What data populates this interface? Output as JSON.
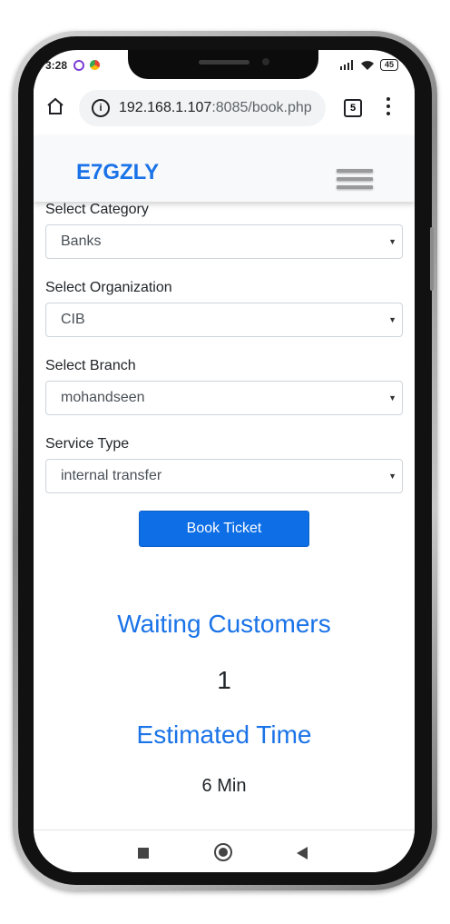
{
  "status_bar": {
    "time": "3:28",
    "battery": "45"
  },
  "browser": {
    "url_host": "192.168.1.107",
    "url_rest": ":8085/book.php",
    "tab_count": "5"
  },
  "navbar": {
    "brand": "E7GZLY"
  },
  "form": {
    "category": {
      "label": "Select Category",
      "value": "Banks"
    },
    "organization": {
      "label": "Select Organization",
      "value": "CIB"
    },
    "branch": {
      "label": "Select Branch",
      "value": "mohandseen"
    },
    "service": {
      "label": "Service Type",
      "value": "internal transfer"
    },
    "submit_label": "Book Ticket"
  },
  "queue": {
    "waiting_title": "Waiting Customers",
    "waiting_count": "1",
    "estimated_title": "Estimated Time",
    "estimated_value": "6 Min"
  },
  "colors": {
    "brand": "#1a73e8",
    "button": "#0d6ee6"
  },
  "icons": [
    "home-icon",
    "info-icon",
    "tabs-icon",
    "menu-kebab-icon",
    "hamburger-icon",
    "dropdown-caret-icon",
    "nav-recents-icon",
    "nav-home-icon",
    "nav-back-icon"
  ]
}
